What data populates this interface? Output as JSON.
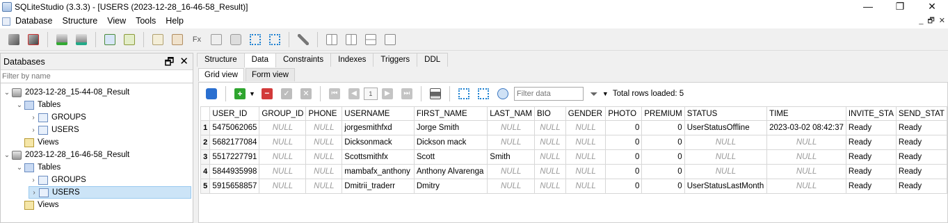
{
  "window": {
    "title": "SQLiteStudio (3.3.3) - [USERS (2023-12-28_16-46-58_Result)]",
    "controls": [
      "—",
      "❐",
      "✕"
    ]
  },
  "menu": [
    "Database",
    "Structure",
    "View",
    "Tools",
    "Help"
  ],
  "mdi_controls": [
    "_",
    "🗗",
    "✕"
  ],
  "databases_panel": {
    "title": "Databases",
    "filter_placeholder": "Filter by name",
    "tree": [
      {
        "label": "2023-12-28_15-44-08_Result"
      },
      {
        "label": "Tables"
      },
      {
        "label": "GROUPS"
      },
      {
        "label": "USERS"
      },
      {
        "label": "Views"
      },
      {
        "label": "2023-12-28_16-46-58_Result"
      },
      {
        "label": "Tables"
      },
      {
        "label": "GROUPS"
      },
      {
        "label": "USERS"
      },
      {
        "label": "Views"
      }
    ]
  },
  "tabs": [
    "Structure",
    "Data",
    "Constraints",
    "Indexes",
    "Triggers",
    "DDL"
  ],
  "active_tab": "Data",
  "subtabs": [
    "Grid view",
    "Form view"
  ],
  "active_subtab": "Grid view",
  "data_toolbar": {
    "page": "1",
    "filter_placeholder": "Filter data",
    "total_rows": "Total rows loaded: 5"
  },
  "grid": {
    "columns": [
      "USER_ID",
      "GROUP_ID",
      "PHONE",
      "USERNAME",
      "FIRST_NAME",
      "LAST_NAM",
      "BIO",
      "GENDER",
      "PHOTO",
      "PREMIUM",
      "STATUS",
      "TIME",
      "INVITE_STA",
      "SEND_STAT"
    ],
    "rows": [
      {
        "num": "1",
        "cells": [
          "5475062065",
          "NULL",
          "NULL",
          "jorgesmithfxd",
          "Jorge Smith",
          "NULL",
          "NULL",
          "NULL",
          "0",
          "0",
          "UserStatusOffline",
          "2023-03-02 08:42:37",
          "Ready",
          "Ready"
        ]
      },
      {
        "num": "2",
        "cells": [
          "5682177084",
          "NULL",
          "NULL",
          "Dicksonmack",
          "Dickson mack",
          "NULL",
          "NULL",
          "NULL",
          "0",
          "0",
          "NULL",
          "NULL",
          "Ready",
          "Ready"
        ]
      },
      {
        "num": "3",
        "cells": [
          "5517227791",
          "NULL",
          "NULL",
          "Scottsmithfx",
          "Scott",
          "Smith",
          "NULL",
          "NULL",
          "0",
          "0",
          "NULL",
          "NULL",
          "Ready",
          "Ready"
        ]
      },
      {
        "num": "4",
        "cells": [
          "5844935998",
          "NULL",
          "NULL",
          "mambafx_anthony",
          "Anthony Alvarenga",
          "NULL",
          "NULL",
          "NULL",
          "0",
          "0",
          "NULL",
          "NULL",
          "Ready",
          "Ready"
        ]
      },
      {
        "num": "5",
        "cells": [
          "5915658857",
          "NULL",
          "NULL",
          "Dmitrii_traderr",
          "Dmitry",
          "NULL",
          "NULL",
          "NULL",
          "0",
          "0",
          "UserStatusLastMonth",
          "NULL",
          "Ready",
          "Ready"
        ]
      }
    ]
  }
}
